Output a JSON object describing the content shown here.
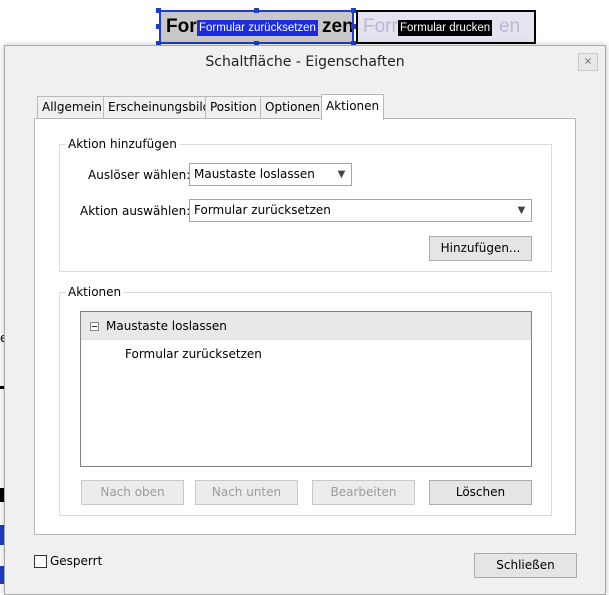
{
  "background": {
    "reset_button": {
      "visible_text": "Forr",
      "visible_text_end": "zen",
      "tooltip": "Formular zurücksetzen"
    },
    "print_button": {
      "visible_text": "Forr",
      "visible_text_end": "en",
      "tooltip": "Formular drucken"
    },
    "edge_char": "e"
  },
  "dialog": {
    "title": "Schaltfläche - Eigenschaften",
    "close_glyph": "×",
    "tabs": [
      {
        "label": "Allgemein"
      },
      {
        "label": "Erscheinungsbild"
      },
      {
        "label": "Position"
      },
      {
        "label": "Optionen"
      },
      {
        "label": "Aktionen",
        "active": true
      }
    ],
    "add_action": {
      "legend": "Aktion hinzufügen",
      "trigger_label": "Auslöser wählen:",
      "trigger_value": "Maustaste loslassen",
      "action_label": "Aktion auswählen:",
      "action_value": "Formular zurücksetzen",
      "add_button": "Hinzufügen..."
    },
    "actions": {
      "legend": "Aktionen",
      "group_title": "Maustaste loslassen",
      "item": "Formular zurücksetzen",
      "buttons": {
        "up": "Nach oben",
        "down": "Nach unten",
        "edit": "Bearbeiten",
        "delete": "Löschen"
      }
    },
    "locked_label": "Gesperrt",
    "close_button": "Schließen"
  },
  "colors": {
    "selection_blue": "#1f3ec8",
    "dialog_bg": "#f0f0f0",
    "disabled_text": "#9c9c9c"
  }
}
